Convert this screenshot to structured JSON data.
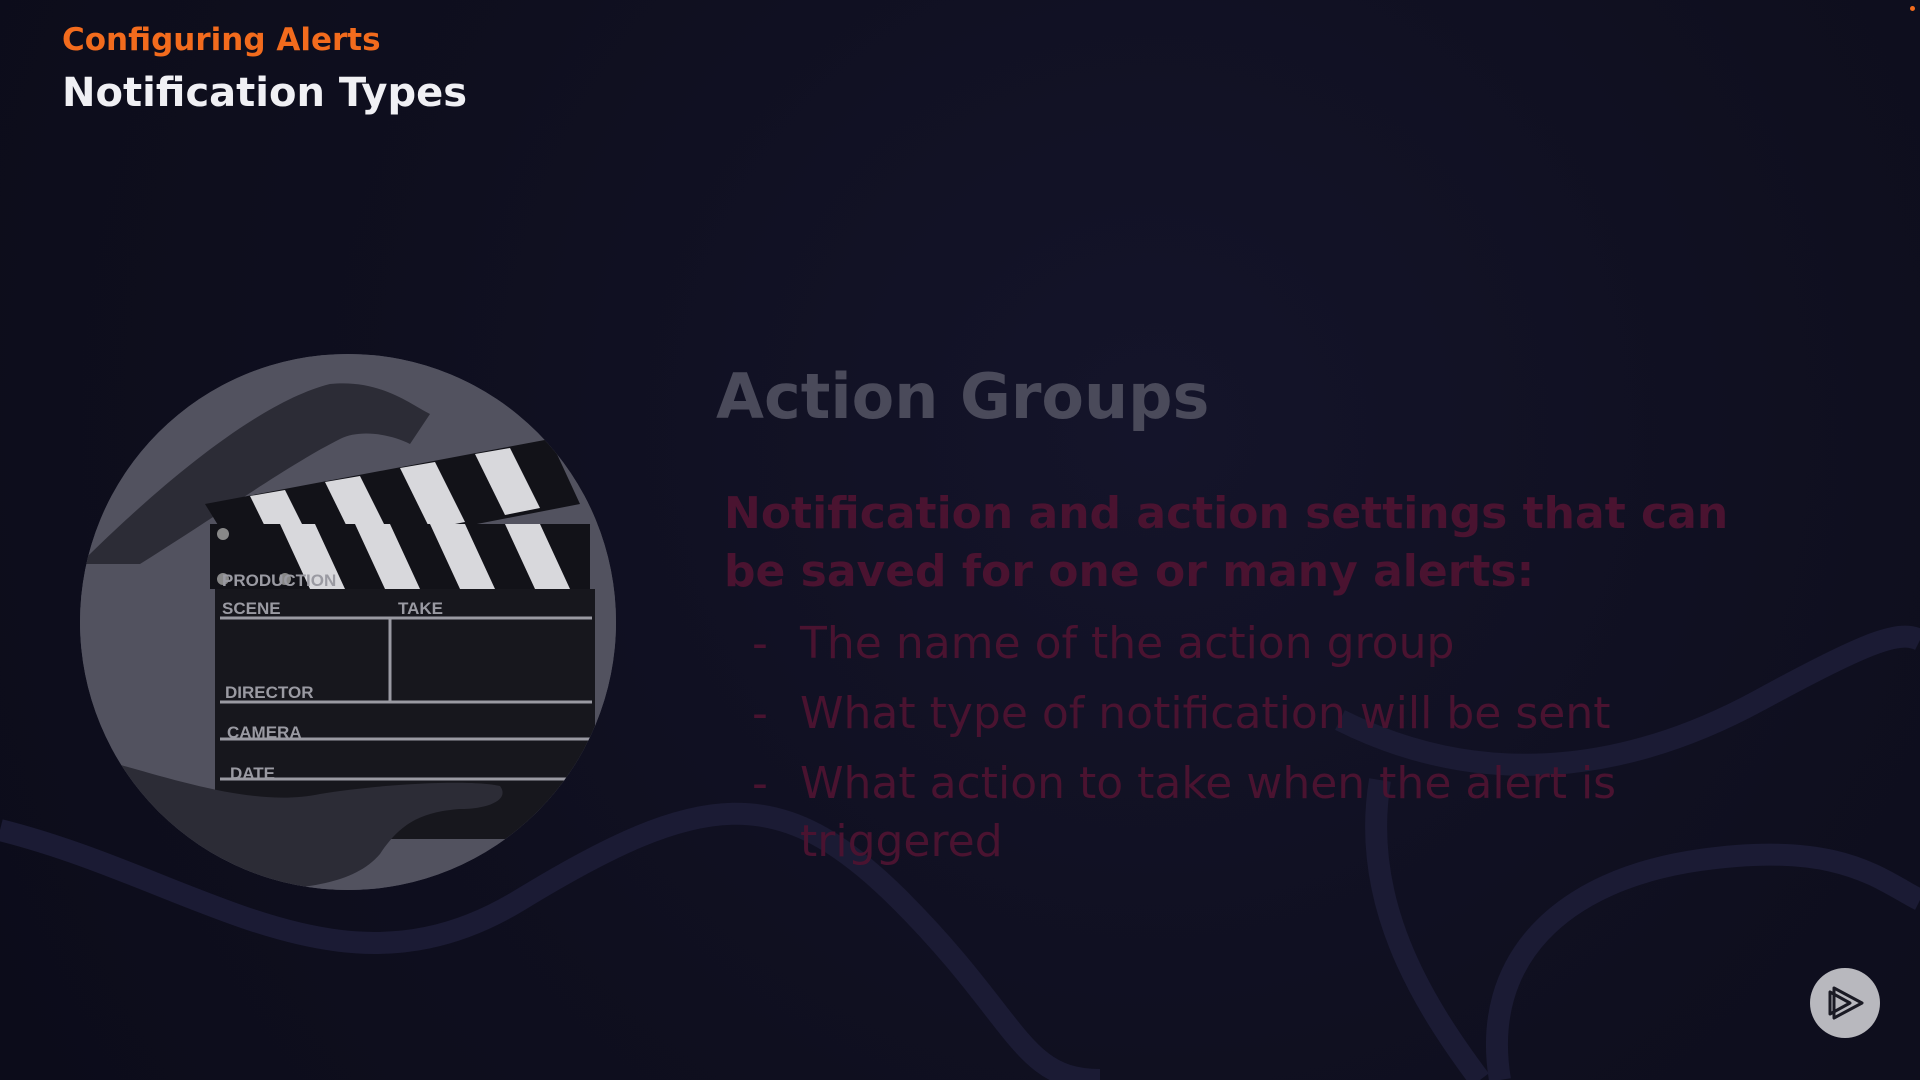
{
  "header": {
    "course_title": "Configuring Alerts",
    "section_title": "Notification Types"
  },
  "image": {
    "icon": "clapperboard-photo",
    "clapperboard_labels": {
      "production": "PRODUCTION",
      "scene": "SCENE",
      "take": "TAKE",
      "director": "DIRECTOR",
      "camera": "CAMERA",
      "date": "DATE"
    }
  },
  "content": {
    "heading": "Action Groups",
    "lead": "Notification and action settings that can be saved for one or many alerts:",
    "bullets": [
      {
        "dash": "-",
        "text": "The name of the action group"
      },
      {
        "dash": "-",
        "text": "What type of notification will be sent"
      },
      {
        "dash": "-",
        "text": "What action to take when the alert is triggered"
      }
    ]
  },
  "controls": {
    "play_icon": "play-icon"
  },
  "colors": {
    "accent": "#f26b1d",
    "background": "#0f0f1f",
    "heading": "#4a4a5a",
    "body_text": "#4a1330"
  }
}
